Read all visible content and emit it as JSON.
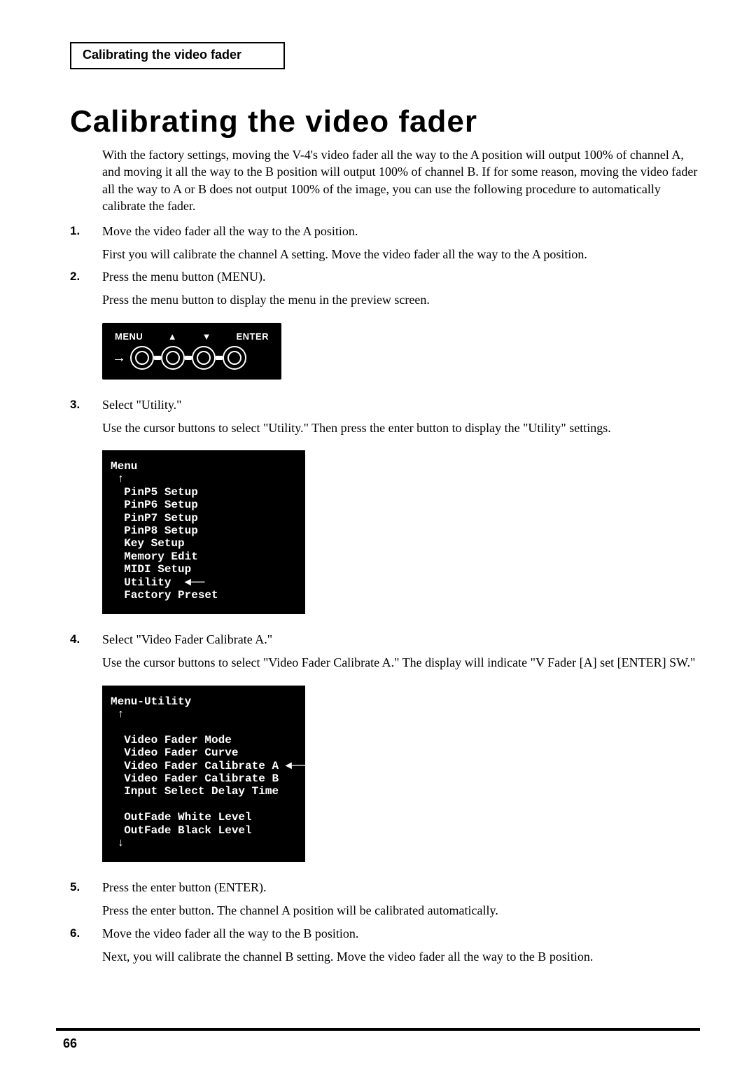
{
  "section_header": "Calibrating the video fader",
  "page_title": "Calibrating the video fader",
  "intro": "With the factory settings, moving the V-4's video fader all the way to the A position will output 100% of channel A, and moving it all the way to the B position will output 100% of channel B. If for some reason, moving the video fader all the way to A or B does not output 100% of the image, you can use the following procedure to automatically calibrate the fader.",
  "steps": {
    "s1": {
      "num": "1.",
      "heading": "Move the video fader all the way to the A position.",
      "body": "First you will calibrate the channel A setting. Move the video fader all the way to the A position."
    },
    "s2": {
      "num": "2.",
      "heading": "Press the menu button (MENU).",
      "body": "Press the menu button to display the menu in the preview screen."
    },
    "s3": {
      "num": "3.",
      "heading": "Select \"Utility.\"",
      "body": "Use the cursor buttons to select \"Utility.\" Then press the enter button to display the \"Utility\" settings."
    },
    "s4": {
      "num": "4.",
      "heading": "Select \"Video Fader Calibrate A.\"",
      "body": "Use the cursor buttons to select \"Video Fader Calibrate A.\" The display will indicate \"V Fader [A] set [ENTER] SW.\""
    },
    "s5": {
      "num": "5.",
      "heading": "Press the enter button (ENTER).",
      "body": "Press the enter button. The channel A position will be calibrated automatically."
    },
    "s6": {
      "num": "6.",
      "heading": "Move the video fader all the way to the B position.",
      "body": "Next, you will calibrate the channel B setting. Move the video fader all the way to the B position."
    }
  },
  "panel": {
    "menu": "MENU",
    "up": "▲",
    "down": "▼",
    "enter": "ENTER"
  },
  "screen1": {
    "title": "Menu",
    "arrow_up": "↑",
    "l1": "PinP5 Setup",
    "l2": "PinP6 Setup",
    "l3": "PinP7 Setup",
    "l4": "PinP8 Setup",
    "l5": "Key Setup",
    "l6": "Memory Edit",
    "l7": "MIDI Setup",
    "l8": "Utility",
    "l8_ptr": "◄──",
    "l9": "Factory Preset"
  },
  "screen2": {
    "title": "Menu-Utility",
    "arrow_up": "↑",
    "l1": "Video Fader Mode",
    "l2": "Video Fader Curve",
    "l3": "Video Fader Calibrate A",
    "l3_ptr": "◄──",
    "l4": "Video Fader Calibrate B",
    "l5": "Input Select Delay Time",
    "l6": "OutFade White Level",
    "l7": "OutFade Black Level",
    "arrow_down": "↓"
  },
  "page_number": "66"
}
